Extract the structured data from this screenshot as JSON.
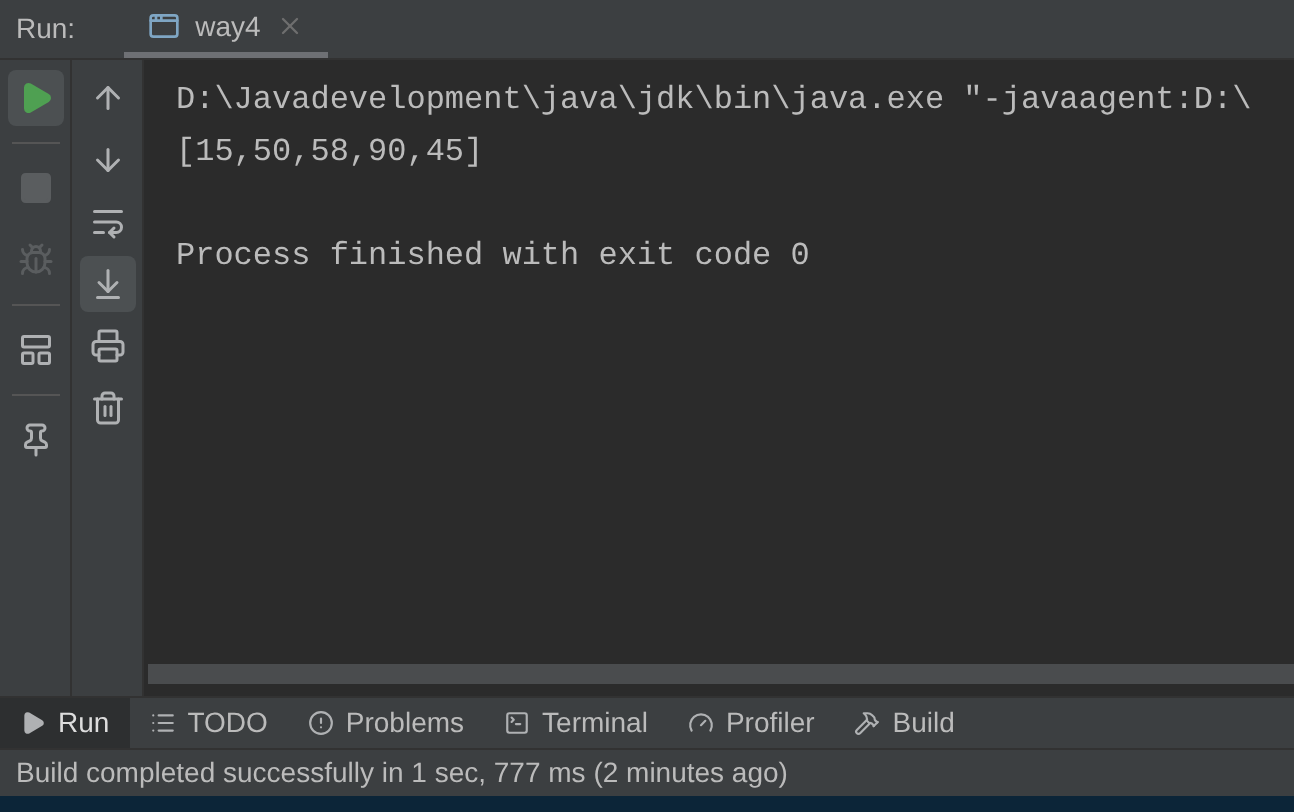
{
  "run_header": {
    "label": "Run:",
    "tab": {
      "title": "way4",
      "selected": true
    }
  },
  "run_toolbar": [
    {
      "kind": "rerun",
      "disabled": false,
      "on": true
    },
    {
      "kind": "stop",
      "disabled": true,
      "on": false
    },
    {
      "kind": "debug",
      "disabled": true,
      "on": false
    },
    {
      "kind": "layout",
      "disabled": false,
      "on": false
    },
    {
      "kind": "pin",
      "disabled": false,
      "on": false
    }
  ],
  "console_toolbar": [
    {
      "kind": "up",
      "on": false
    },
    {
      "kind": "down",
      "on": false
    },
    {
      "kind": "wrap",
      "on": false
    },
    {
      "kind": "scroll_end",
      "on": true
    },
    {
      "kind": "print",
      "on": false
    },
    {
      "kind": "clear",
      "on": false
    }
  ],
  "console_lines": [
    {
      "kind": "command",
      "text": "D:\\Javadevelopment\\java\\jdk\\bin\\java.exe \"-javaagent:D:\\"
    },
    {
      "kind": "output",
      "text": "[15,50,58,90,45]"
    },
    {
      "kind": "exit",
      "text": "Process finished with exit code 0"
    }
  ],
  "tool_tabs": [
    {
      "kind": "run",
      "label": "Run",
      "selected": true
    },
    {
      "kind": "todo",
      "label": "TODO",
      "selected": false
    },
    {
      "kind": "problems",
      "label": "Problems",
      "selected": false
    },
    {
      "kind": "terminal",
      "label": "Terminal",
      "selected": false
    },
    {
      "kind": "profiler",
      "label": "Profiler",
      "selected": false
    },
    {
      "kind": "build",
      "label": "Build",
      "selected": false
    }
  ],
  "status_bar": "Build completed successfully in 1 sec, 777 ms (2 minutes ago)"
}
